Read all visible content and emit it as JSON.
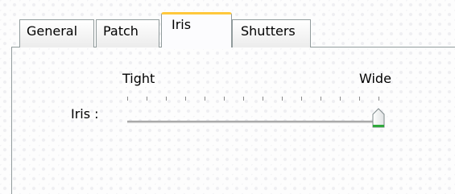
{
  "tabs": [
    {
      "label": "General",
      "active": false
    },
    {
      "label": "Patch",
      "active": false
    },
    {
      "label": "Iris",
      "active": true
    },
    {
      "label": "Shutters",
      "active": false
    }
  ],
  "iris": {
    "label": "Iris :",
    "min_label": "Tight",
    "max_label": "Wide",
    "value": 1.0,
    "tick_count": 14
  },
  "colors": {
    "active_tab_accent": "#ffc83c",
    "slider_thumb_bottom": "#2fa83c"
  }
}
